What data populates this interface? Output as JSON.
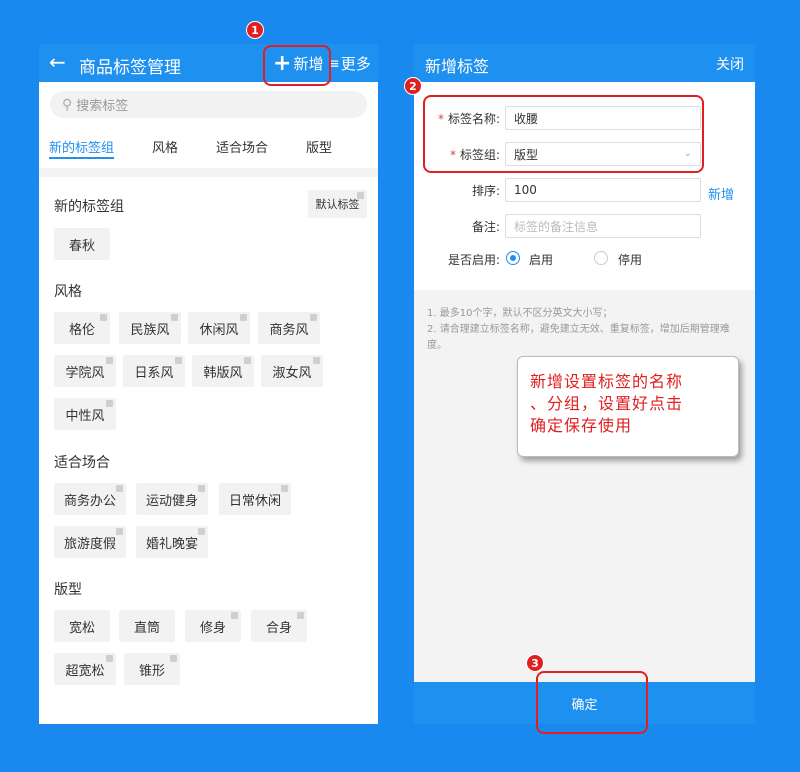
{
  "left": {
    "header": {
      "back_icon": "←",
      "title": "商品标签管理",
      "add_icon": "+",
      "add_label": "新增",
      "more_icon": "≡",
      "more_label": "更多"
    },
    "search": {
      "icon": "⚲",
      "placeholder": "搜索标签"
    },
    "tabs": [
      {
        "label": "新的标签组"
      },
      {
        "label": "风格"
      },
      {
        "label": "适合场合"
      },
      {
        "label": "版型"
      }
    ],
    "default_button": "默认标签",
    "groups": [
      {
        "title": "新的标签组",
        "chips": [
          "春秋"
        ]
      },
      {
        "title": "风格",
        "chips": [
          "格伦",
          "民族风",
          "休闲风",
          "商务风",
          "学院风",
          "日系风",
          "韩版风",
          "淑女风",
          "中性风"
        ]
      },
      {
        "title": "适合场合",
        "chips": [
          "商务办公",
          "运动健身",
          "日常休闲",
          "旅游度假",
          "婚礼晚宴"
        ]
      },
      {
        "title": "版型",
        "chips": [
          "宽松",
          "直筒",
          "修身",
          "合身",
          "超宽松",
          "锥形"
        ]
      }
    ]
  },
  "right": {
    "header": {
      "title": "新增标签",
      "close": "关闭"
    },
    "form": {
      "name_label": "标签名称:",
      "name_value": "收腰",
      "group_label": "标签组:",
      "group_value": "版型",
      "new_link": "新增",
      "order_label": "排序:",
      "order_value": "100",
      "remark_label": "备注:",
      "remark_placeholder": "标签的备注信息",
      "enable_label": "是否启用:",
      "enable_on": "启用",
      "enable_off": "停用",
      "required_mark": "*"
    },
    "tips": [
      "1. 最多10个字，默认不区分英文大小写；",
      "2. 请合理建立标签名称，避免建立无效、重复标签，增加后期管理难度。"
    ],
    "callout_lines": [
      "新增设置标签的名称",
      "、分组，设置好点击",
      "确定保存使用"
    ],
    "confirm": "确定"
  },
  "badges": [
    "1",
    "2",
    "3"
  ],
  "colors": {
    "brand": "#1e90f0",
    "annotation": "#e02020",
    "background": "#1989f0"
  }
}
